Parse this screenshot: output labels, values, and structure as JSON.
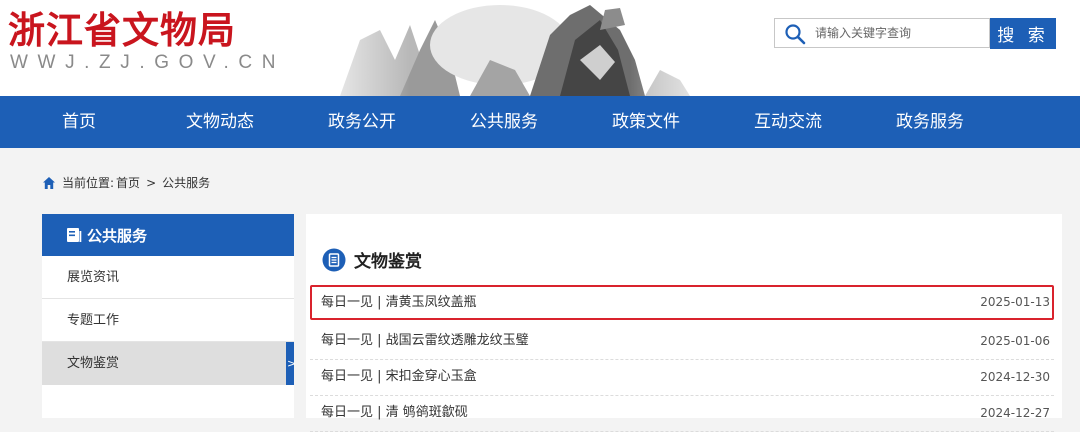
{
  "header": {
    "logo_title": "浙江省文物局",
    "logo_domain": "WWJ.ZJ.GOV.CN",
    "search_placeholder": "请输入关键字查询",
    "search_button": "搜 索"
  },
  "nav": {
    "items": [
      "首页",
      "文物动态",
      "政务公开",
      "公共服务",
      "政策文件",
      "互动交流",
      "政务服务"
    ]
  },
  "breadcrumb": {
    "label": "当前位置:",
    "items": [
      "首页",
      "公共服务"
    ],
    "separator": ">"
  },
  "sidebar": {
    "title": "公共服务",
    "items": [
      {
        "label": "展览资讯",
        "active": false
      },
      {
        "label": "专题工作",
        "active": false
      },
      {
        "label": "文物鉴赏",
        "active": true
      }
    ],
    "active_arrow": ">"
  },
  "main": {
    "section_title": "文物鉴赏",
    "articles": [
      {
        "title": "每日一见 | 清黄玉凤纹盖瓶",
        "date": "2025-01-13",
        "highlighted": true
      },
      {
        "title": "每日一见 | 战国云雷纹透雕龙纹玉璧",
        "date": "2025-01-06",
        "highlighted": false
      },
      {
        "title": "每日一见 | 宋扣金穿心玉盒",
        "date": "2024-12-30",
        "highlighted": false
      },
      {
        "title": "每日一见 | 清 鸲鹆斑歙砚",
        "date": "2024-12-27",
        "highlighted": false
      }
    ]
  },
  "colors": {
    "brand_red": "#c9151e",
    "brand_blue": "#1d5fb6",
    "highlight_border": "#d9232d",
    "page_background": "#f3f3f3"
  },
  "icons": {
    "search": "search-icon",
    "home": "home-icon",
    "sidebar_header": "book-icon",
    "section": "list-icon"
  }
}
